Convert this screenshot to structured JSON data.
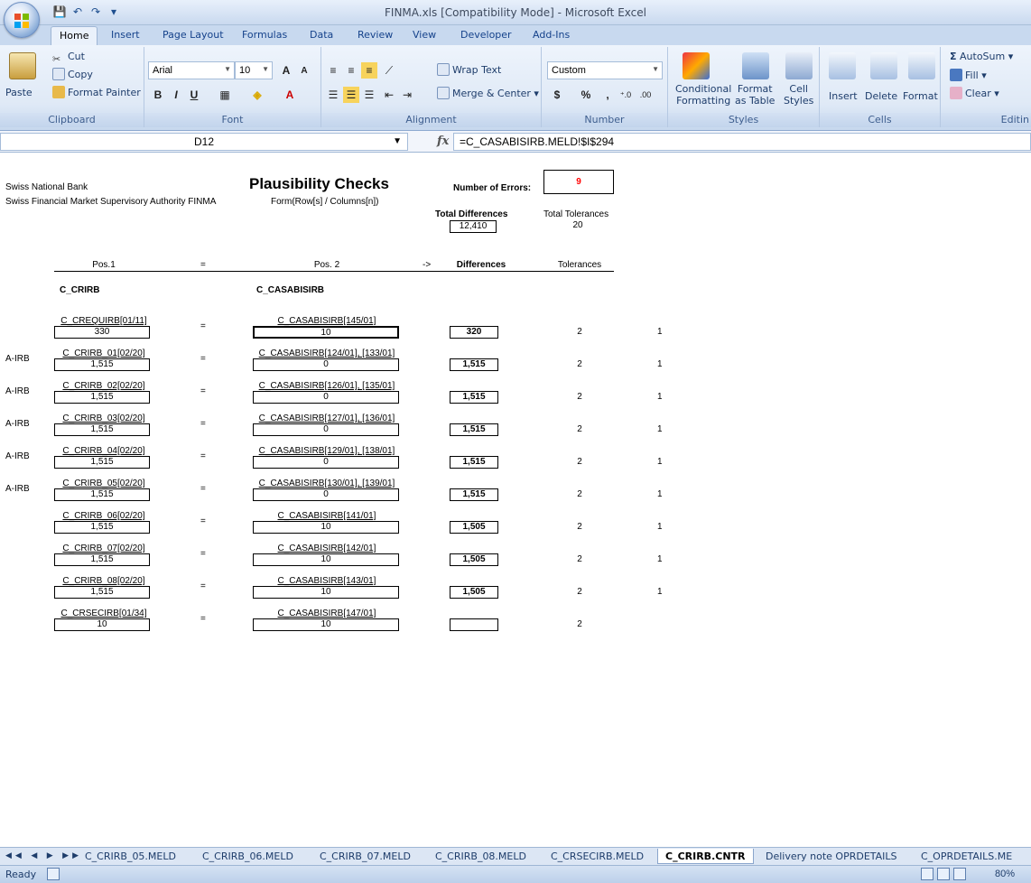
{
  "window": {
    "title": "FINMA.xls  [Compatibility Mode] - Microsoft Excel"
  },
  "tabs": [
    "Home",
    "Insert",
    "Page Layout",
    "Formulas",
    "Data",
    "Review",
    "View",
    "Developer",
    "Add-Ins"
  ],
  "ribbon": {
    "clipboard": {
      "paste": "Paste",
      "cut": "Cut",
      "copy": "Copy",
      "format_painter": "Format Painter",
      "label": "Clipboard"
    },
    "font": {
      "name": "Arial",
      "size": "10",
      "label": "Font"
    },
    "alignment": {
      "wrap": "Wrap Text",
      "merge": "Merge & Center",
      "label": "Alignment"
    },
    "number": {
      "format": "Custom",
      "label": "Number"
    },
    "styles": {
      "conditional": "Conditional",
      "conditional2": "Formatting",
      "format": "Format",
      "format2": "as Table",
      "cell": "Cell",
      "cell2": "Styles",
      "label": "Styles"
    },
    "cells": {
      "insert": "Insert",
      "delete": "Delete",
      "format": "Format",
      "label": "Cells"
    },
    "editing": {
      "autosum": "AutoSum",
      "fill": "Fill",
      "clear": "Clear",
      "label": "Editin"
    }
  },
  "formula_bar": {
    "name_box": "D12",
    "formula": "=C_CASABISIRB.MELD!$I$294"
  },
  "sheet": {
    "org1": "Swiss National Bank",
    "org2": "Swiss Financial Market Supervisory Authority FINMA",
    "title": "Plausibility Checks",
    "form_hint": "Form(Row[s] / Columns[n])",
    "errors_label": "Number of Errors:",
    "errors_value": "9",
    "total_diff_label": "Total Differences",
    "total_diff_value": "12,410",
    "total_tol_label": "Total Tolerances",
    "total_tol_value": "20",
    "headers": {
      "pos1": "Pos.1",
      "eq": "=",
      "pos2": "Pos. 2",
      "arrow": "->",
      "diff": "Differences",
      "tol": "Tolerances"
    },
    "section_left": "C_CRIRB",
    "section_right": "C_CASABISIRB",
    "rows": [
      {
        "prefix": "",
        "pos1": "C_CREQUIRB[01/11]",
        "v1": "330",
        "eq": "=",
        "pos2": "C_CASABISIRB[145/01]",
        "v2": "10",
        "diff": "320",
        "tol": "2",
        "flag": "1"
      },
      {
        "prefix": "A-IRB",
        "pos1": "C_CRIRB_01[02/20]",
        "v1": "1,515",
        "eq": "=",
        "pos2": "C_CASABISIRB[124/01], [133/01]",
        "v2": "0",
        "diff": "1,515",
        "tol": "2",
        "flag": "1"
      },
      {
        "prefix": "A-IRB",
        "pos1": "C_CRIRB_02[02/20]",
        "v1": "1,515",
        "eq": "=",
        "pos2": "C_CASABISIRB[126/01], [135/01]",
        "v2": "0",
        "diff": "1,515",
        "tol": "2",
        "flag": "1"
      },
      {
        "prefix": "A-IRB",
        "pos1": "C_CRIRB_03[02/20]",
        "v1": "1,515",
        "eq": "=",
        "pos2": "C_CASABISIRB[127/01], [136/01]",
        "v2": "0",
        "diff": "1,515",
        "tol": "2",
        "flag": "1"
      },
      {
        "prefix": "A-IRB",
        "pos1": "C_CRIRB_04[02/20]",
        "v1": "1,515",
        "eq": "=",
        "pos2": "C_CASABISIRB[129/01], [138/01]",
        "v2": "0",
        "diff": "1,515",
        "tol": "2",
        "flag": "1"
      },
      {
        "prefix": "A-IRB",
        "pos1": "C_CRIRB_05[02/20]",
        "v1": "1,515",
        "eq": "=",
        "pos2": "C_CASABISIRB[130/01], [139/01]",
        "v2": "0",
        "diff": "1,515",
        "tol": "2",
        "flag": "1"
      },
      {
        "prefix": "",
        "pos1": "C_CRIRB_06[02/20]",
        "v1": "1,515",
        "eq": "=",
        "pos2": "C_CASABISIRB[141/01]",
        "v2": "10",
        "diff": "1,505",
        "tol": "2",
        "flag": "1"
      },
      {
        "prefix": "",
        "pos1": "C_CRIRB_07[02/20]",
        "v1": "1,515",
        "eq": "=",
        "pos2": "C_CASABISIRB[142/01]",
        "v2": "10",
        "diff": "1,505",
        "tol": "2",
        "flag": "1"
      },
      {
        "prefix": "",
        "pos1": "C_CRIRB_08[02/20]",
        "v1": "1,515",
        "eq": "=",
        "pos2": "C_CASABISIRB[143/01]",
        "v2": "10",
        "diff": "1,505",
        "tol": "2",
        "flag": "1"
      },
      {
        "prefix": "",
        "pos1": "C_CRSECIRB[01/34]",
        "v1": "10",
        "eq": "=",
        "pos2": "C_CASABISIRB[147/01]",
        "v2": "10",
        "diff": "",
        "tol": "2",
        "flag": ""
      }
    ]
  },
  "sheet_tabs": [
    "C_CRIRB_05.MELD",
    "C_CRIRB_06.MELD",
    "C_CRIRB_07.MELD",
    "C_CRIRB_08.MELD",
    "C_CRSECIRB.MELD",
    "C_CRIRB.CNTR",
    "Delivery note OPRDETAILS",
    "C_OPRDETAILS.ME"
  ],
  "active_sheet": "C_CRIRB.CNTR",
  "status": {
    "ready": "Ready",
    "zoom": "80%"
  },
  "colors": {
    "error_red": "#ff0000",
    "accent": "#15428b"
  }
}
